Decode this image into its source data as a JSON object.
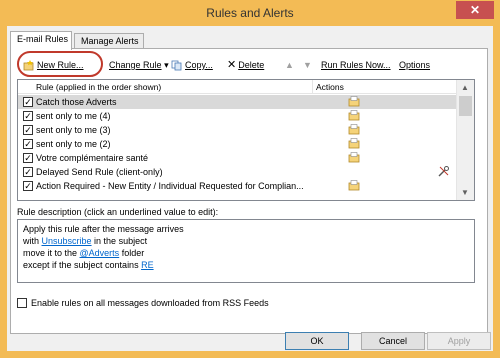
{
  "window": {
    "title": "Rules and Alerts",
    "close_glyph": "✕"
  },
  "tabs": [
    {
      "label": "E-mail Rules",
      "active": true
    },
    {
      "label": "Manage Alerts",
      "active": false
    }
  ],
  "toolbar": {
    "new_rule": "New Rule...",
    "change_rule": "Change Rule",
    "copy": "Copy...",
    "delete": "Delete",
    "run_rules": "Run Rules Now...",
    "options": "Options"
  },
  "rules_table": {
    "headers": {
      "rule": "Rule (applied in the order shown)",
      "actions": "Actions"
    },
    "rows": [
      {
        "name": "Catch those Adverts",
        "checked": true,
        "selected": true,
        "action_icon": "move-to-folder-icon"
      },
      {
        "name": "sent only to me (4)",
        "checked": true,
        "selected": false,
        "action_icon": "move-to-folder-icon"
      },
      {
        "name": "sent only to me (3)",
        "checked": true,
        "selected": false,
        "action_icon": "move-to-folder-icon"
      },
      {
        "name": "sent only to me (2)",
        "checked": true,
        "selected": false,
        "action_icon": "move-to-folder-icon"
      },
      {
        "name": "Votre complémentaire santé",
        "checked": true,
        "selected": false,
        "action_icon": "move-to-folder-icon"
      },
      {
        "name": "Delayed Send Rule  (client-only)",
        "checked": true,
        "selected": false,
        "action_icon": "tools-icon"
      },
      {
        "name": "Action Required - New Entity / Individual Requested for Complian...",
        "checked": true,
        "selected": false,
        "action_icon": "move-to-folder-icon"
      }
    ]
  },
  "description": {
    "label": "Rule description (click an underlined value to edit):",
    "line1": "Apply this rule after the message arrives",
    "line2_pre": "with ",
    "line2_link": "Unsubscribe",
    "line2_post": " in the subject",
    "line3_pre": "move it to the ",
    "line3_link": "@Adverts",
    "line3_post": " folder",
    "line4_pre": "except if the subject contains ",
    "line4_link": "RE"
  },
  "rss": {
    "label": "Enable rules on all messages downloaded from RSS Feeds",
    "checked": false
  },
  "buttons": {
    "ok": "OK",
    "cancel": "Cancel",
    "apply": "Apply"
  },
  "colors": {
    "titlebar": "#f3bb55",
    "close": "#c75050",
    "highlight": "#c0392b",
    "link": "#0066cc"
  }
}
